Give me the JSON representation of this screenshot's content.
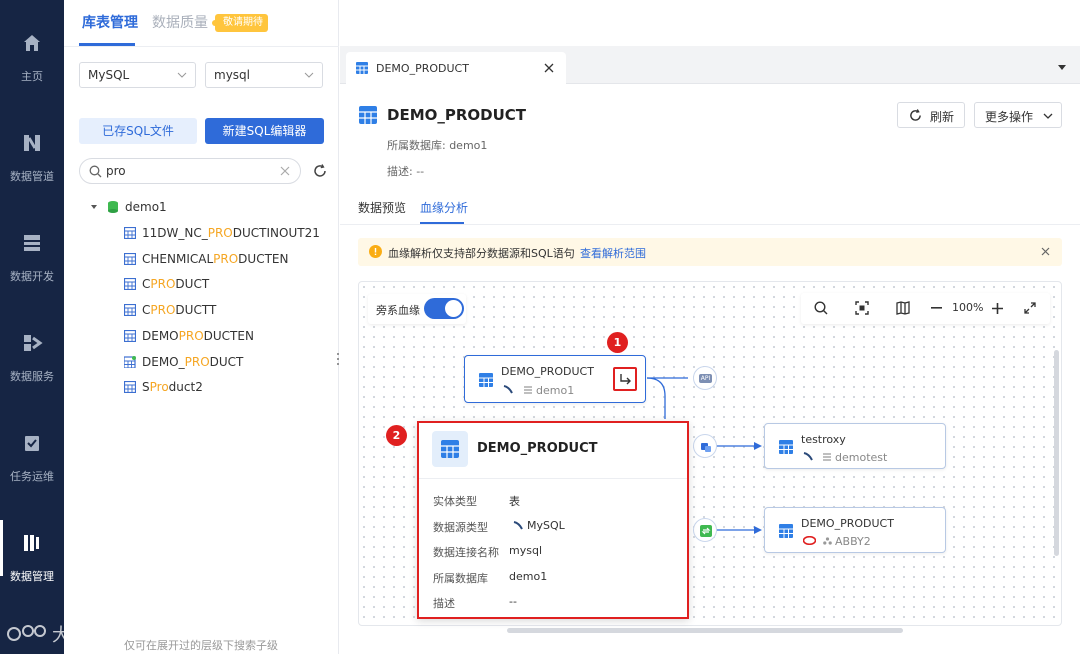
{
  "nav": {
    "items": [
      {
        "label": "主页",
        "icon": "home-icon"
      },
      {
        "label": "数据管道",
        "icon": "pipeline-icon"
      },
      {
        "label": "数据开发",
        "icon": "dev-icon"
      },
      {
        "label": "数据服务",
        "icon": "service-icon"
      },
      {
        "label": "任务运维",
        "icon": "ops-icon"
      },
      {
        "label": "数据管理",
        "icon": "manage-icon"
      }
    ]
  },
  "left": {
    "tab_active": "库表管理",
    "tab_inactive": "数据质量",
    "badge": "敬请期待",
    "db_type": "MySQL",
    "db_name": "mysql",
    "saved_sql": "已存SQL文件",
    "new_sql": "新建SQL编辑器",
    "search_value": "pro",
    "database": "demo1",
    "tables": [
      {
        "pre": "11DW_NC_",
        "hl": "PRO",
        "post": "DUCTINOUT21"
      },
      {
        "pre": "CHENMICAL",
        "hl": "PRO",
        "post": "DUCTEN"
      },
      {
        "pre": "C",
        "hl": "PRO",
        "post": "DUCT"
      },
      {
        "pre": "C",
        "hl": "PRO",
        "post": "DUCTT"
      },
      {
        "pre": "DEMO",
        "hl": "PRO",
        "post": "DUCTEN"
      },
      {
        "pre": "DEMO_",
        "hl": "PRO",
        "post": "DUCT"
      },
      {
        "pre": "S",
        "hl": "Pro",
        "post": "duct2"
      }
    ],
    "footer_hint": "仅可在展开过的层级下搜索子级",
    "watermark": "大数跨境"
  },
  "right": {
    "tab_label": "DEMO_PRODUCT",
    "title": "DEMO_PRODUCT",
    "db_line": "所属数据库: demo1",
    "desc_line": "描述: --",
    "refresh": "刷新",
    "more": "更多操作",
    "subtab_preview": "数据预览",
    "subtab_lineage": "血缘分析",
    "notice": "血缘解析仅支持部分数据源和SQL语句",
    "notice_link": "查看解析范围",
    "side_lineage": "旁系血缘",
    "zoom": "100%"
  },
  "graph": {
    "source": {
      "title": "DEMO_PRODUCT",
      "db": "demo1"
    },
    "target1": {
      "title": "testroxy",
      "db": "demotest"
    },
    "target2": {
      "title": "DEMO_PRODUCT",
      "db": "ABBY2"
    },
    "api_badge": "API",
    "marker1": "1",
    "marker2": "2"
  },
  "detail": {
    "title": "DEMO_PRODUCT",
    "rows": [
      {
        "k": "实体类型",
        "v": "表"
      },
      {
        "k": "数据源类型",
        "v": "MySQL"
      },
      {
        "k": "数据连接名称",
        "v": "mysql"
      },
      {
        "k": "所属数据库",
        "v": "demo1"
      },
      {
        "k": "描述",
        "v": "--"
      }
    ]
  },
  "colors": {
    "nav_bg": "#162544",
    "primary": "#2f6bd9",
    "highlight": "#f5a623",
    "marker_red": "#e02020"
  }
}
